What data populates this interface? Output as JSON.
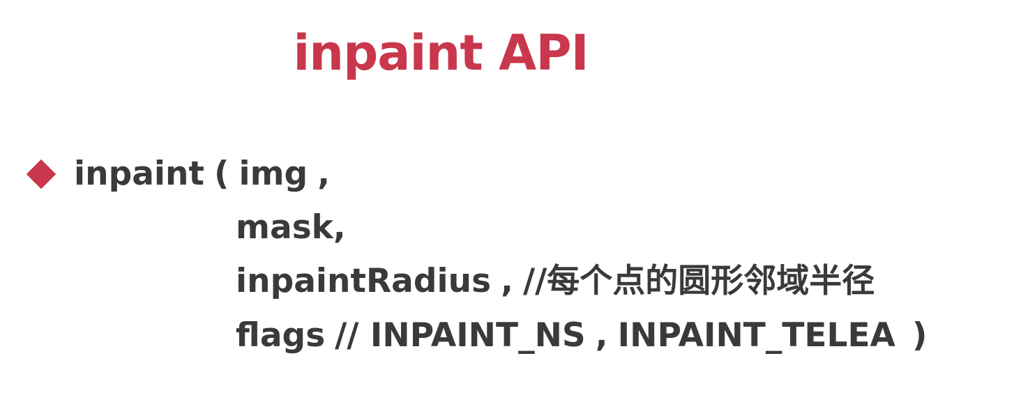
{
  "slide": {
    "title": "inpaint API",
    "accent_color": "#c9374c",
    "text_color": "#3a3a3a",
    "bullet_icon": "diamond-bullet-icon",
    "code_lines": {
      "l1_func": "inpaint",
      "l1_paren": "(",
      "l1_arg": "img",
      "l1_comma": ",",
      "l2_arg": "mask,",
      "l3_arg": "inpaintRadius",
      "l3_comma": ",",
      "l3_comment": "//每个点的圆形邻域半径",
      "l4_arg": "flags",
      "l4_comment": "// INPAINT_NS",
      "l4_comma": ",",
      "l4_option": "INPAINT_TELEA",
      "l4_close": ")"
    }
  }
}
